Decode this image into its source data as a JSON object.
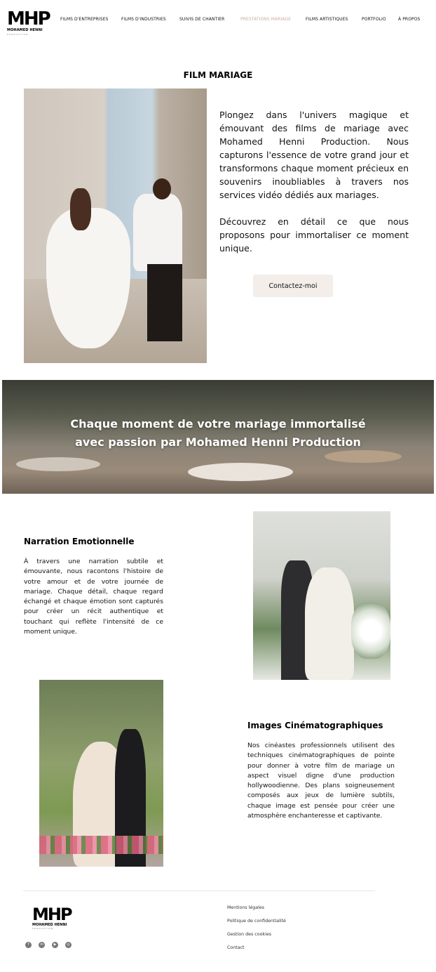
{
  "header": {
    "logo_mark": "MHP",
    "logo_name": "MOHAMED HENNI",
    "logo_sub": "PRODUCTION",
    "nav": [
      {
        "label": "FILMS D'ENTREPRISES",
        "active": false
      },
      {
        "label": "FILMS D'INDUSTRIES",
        "active": false
      },
      {
        "label": "SUIVIS DE CHANTIER",
        "active": false
      },
      {
        "label": "PRESTATIONS MARIAGE",
        "active": true
      },
      {
        "label": "FILMS ARTISTIQUES",
        "active": false
      },
      {
        "label": "PORTFOLIO",
        "active": false
      },
      {
        "label": "À PROPOS",
        "active": false
      }
    ],
    "active_color": "#c9ad9a"
  },
  "hero": {
    "title": "FILM MARIAGE",
    "paragraph1": "Plongez dans l'univers magique et émouvant des films de mariage avec Mohamed Henni Production. Nous capturons l'essence de votre grand jour et transformons chaque moment précieux en souvenirs inoubliables à travers nos services vidéo dédiés aux mariages.",
    "paragraph2": "Découvrez en détail ce que nous proposons pour immortaliser ce moment unique.",
    "cta_label": "Contactez-moi"
  },
  "banner": {
    "line1": "Chaque moment de votre mariage immortalisé",
    "line2": "avec passion par Mohamed Henni Production"
  },
  "features": [
    {
      "title": "Narration Emotionnelle",
      "text": "À travers une narration subtile et émouvante, nous racontons l'histoire de votre amour et de votre journée de mariage. Chaque détail, chaque regard échangé et chaque émotion sont capturés pour créer un récit authentique et touchant qui reflète l'intensité de ce moment unique."
    },
    {
      "title": "Images Cinématographiques",
      "text": "Nos cinéastes professionnels utilisent des techniques cinématographiques de pointe pour donner à votre film de mariage un aspect visuel digne d'une production hollywoodienne. Des plans soigneusement composés aux jeux de lumière subtils, chaque image est pensée pour créer une atmosphère enchanteresse et captivante."
    }
  ],
  "footer": {
    "logo_mark": "MHP",
    "logo_name": "MOHAMED HENNI",
    "logo_sub": "PRODUCTION",
    "socials": [
      "facebook-icon",
      "linkedin-icon",
      "youtube-icon",
      "instagram-icon"
    ],
    "links": [
      "Mentions légales",
      "Politique de confidentialité",
      "Gestion des cookies",
      "Contact"
    ]
  }
}
